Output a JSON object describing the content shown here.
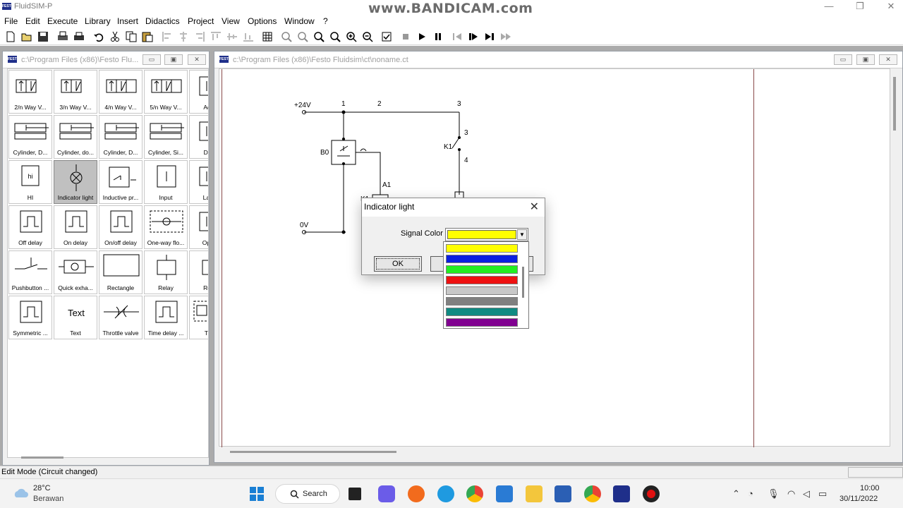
{
  "app": {
    "title": "FluidSIM-P",
    "watermark": "www.BANDICAM.com"
  },
  "menu": [
    "File",
    "Edit",
    "Execute",
    "Library",
    "Insert",
    "Didactics",
    "Project",
    "View",
    "Options",
    "Window",
    "?"
  ],
  "library_window": {
    "title": "c:\\Program Files (x86)\\Festo Flu...",
    "components": [
      {
        "label": "2/n Way V...",
        "icon": "valve-2way-icon"
      },
      {
        "label": "3/n Way V...",
        "icon": "valve-3way-icon"
      },
      {
        "label": "4/n Way V...",
        "icon": "valve-4way-icon"
      },
      {
        "label": "5/n Way V...",
        "icon": "valve-5way-icon"
      },
      {
        "label": "Adjus",
        "icon": "adjustable-icon"
      },
      {
        "label": "Cylinder, D...",
        "icon": "cylinder-double-icon"
      },
      {
        "label": "Cylinder, do...",
        "icon": "cylinder-double-rod-icon"
      },
      {
        "label": "Cylinder, D...",
        "icon": "cylinder-double-2-icon"
      },
      {
        "label": "Cylinder, Si...",
        "icon": "cylinder-single-icon"
      },
      {
        "label": "Deter",
        "icon": "detent-icon"
      },
      {
        "label": "HI",
        "icon": "hi-icon"
      },
      {
        "label": "Indicator light",
        "icon": "indicator-light-icon",
        "selected": true
      },
      {
        "label": "Inductive pr...",
        "icon": "inductive-sensor-icon"
      },
      {
        "label": "Input",
        "icon": "input-icon"
      },
      {
        "label": "Latchi",
        "icon": "latching-icon"
      },
      {
        "label": "Off delay",
        "icon": "off-delay-icon"
      },
      {
        "label": "On delay",
        "icon": "on-delay-icon"
      },
      {
        "label": "On/off delay",
        "icon": "on-off-delay-icon"
      },
      {
        "label": "One-way flo...",
        "icon": "one-way-flow-icon"
      },
      {
        "label": "Optica",
        "icon": "optical-icon"
      },
      {
        "label": "Pushbutton ...",
        "icon": "pushbutton-icon"
      },
      {
        "label": "Quick exha...",
        "icon": "quick-exhaust-icon"
      },
      {
        "label": "Rectangle",
        "icon": "rectangle-icon"
      },
      {
        "label": "Relay",
        "icon": "relay-icon"
      },
      {
        "label": "Relay",
        "icon": "relay-2-icon"
      },
      {
        "label": "Symmetric ...",
        "icon": "symmetric-icon"
      },
      {
        "label": "Text",
        "icon": "text-icon",
        "glyph": "Text"
      },
      {
        "label": "Throttle valve",
        "icon": "throttle-valve-icon"
      },
      {
        "label": "Time delay ...",
        "icon": "time-delay-icon"
      },
      {
        "label": "Time",
        "icon": "time-icon"
      }
    ]
  },
  "circuit_window": {
    "title": "c:\\Program Files (x86)\\Festo Fluidsim\\ct\\noname.ct",
    "labels": {
      "v24": "+24V",
      "v0": "0V",
      "n1": "1",
      "n2": "2",
      "n3": "3",
      "k1_top": "K1",
      "k1_pin3": "3",
      "k1_pin4": "4",
      "b0": "B0",
      "a1": "A1",
      "k1_coil": "K1"
    }
  },
  "dialog": {
    "title": "Indicator light",
    "signal_label": "Signal Color",
    "selected_color": "#ffff00",
    "ok_label": "OK",
    "color_options": [
      "#ffff00",
      "#0a1ee0",
      "#22ee22",
      "#ee1111",
      "#c8c8c8",
      "#808080",
      "#0f8a82",
      "#800090"
    ]
  },
  "status": {
    "text": "Edit Mode (Circuit changed)"
  },
  "taskbar": {
    "temperature": "28°C",
    "weather": "Berawan",
    "search_label": "Search",
    "time": "10:00",
    "date": "30/11/2022"
  }
}
